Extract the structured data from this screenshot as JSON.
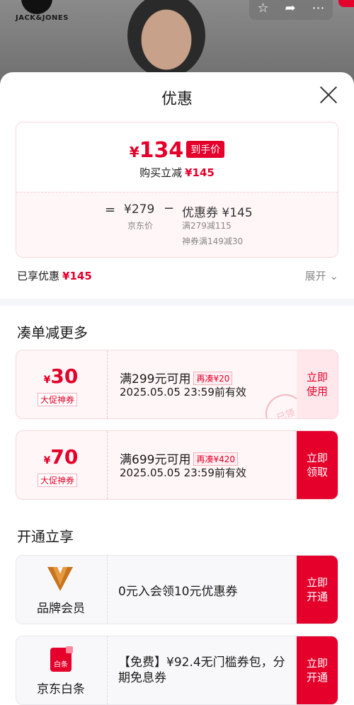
{
  "header": {
    "brand": "JACK&JONES",
    "sheet_title": "优惠"
  },
  "summary": {
    "price_symbol": "¥",
    "price": "134",
    "price_tag": "到手价",
    "save_label": "购买立减",
    "save_amount": "¥145",
    "eq": "=",
    "jd_price": "¥279",
    "jd_label": "京东价",
    "minus": "−",
    "coupon_total": "优惠券 ¥145",
    "coupon_line1": "满279减115",
    "coupon_line2": "神券满149减30"
  },
  "enjoyed": {
    "label": "已享优惠",
    "amount": "¥145",
    "expand": "展开 ⌄"
  },
  "section1_title": "凑单减更多",
  "coupons": [
    {
      "symbol": "¥",
      "amount": "30",
      "label": "大促神券",
      "condition": "满299元可用",
      "more": "再凑¥20",
      "date": "2025.05.05 23:59前有效",
      "button": "立即\n使用",
      "stamp": "已领"
    },
    {
      "symbol": "¥",
      "amount": "70",
      "label": "大促神券",
      "condition": "满699元可用",
      "more": "再凑¥420",
      "date": "2025.05.05 23:59前有效",
      "button": "立即\n领取"
    }
  ],
  "section2_title": "开通立享",
  "perks": [
    {
      "name": "品牌会员",
      "desc": "0元入会领10元优惠券",
      "button": "立即\n开通"
    },
    {
      "name": "京东白条",
      "logo_text": "白条",
      "desc": "【免费】¥92.4无门槛券包，分期免息券",
      "button": "立即\n开通"
    }
  ],
  "colors": {
    "accent": "#e4002b",
    "coupon_bg": "#fff6f7"
  }
}
